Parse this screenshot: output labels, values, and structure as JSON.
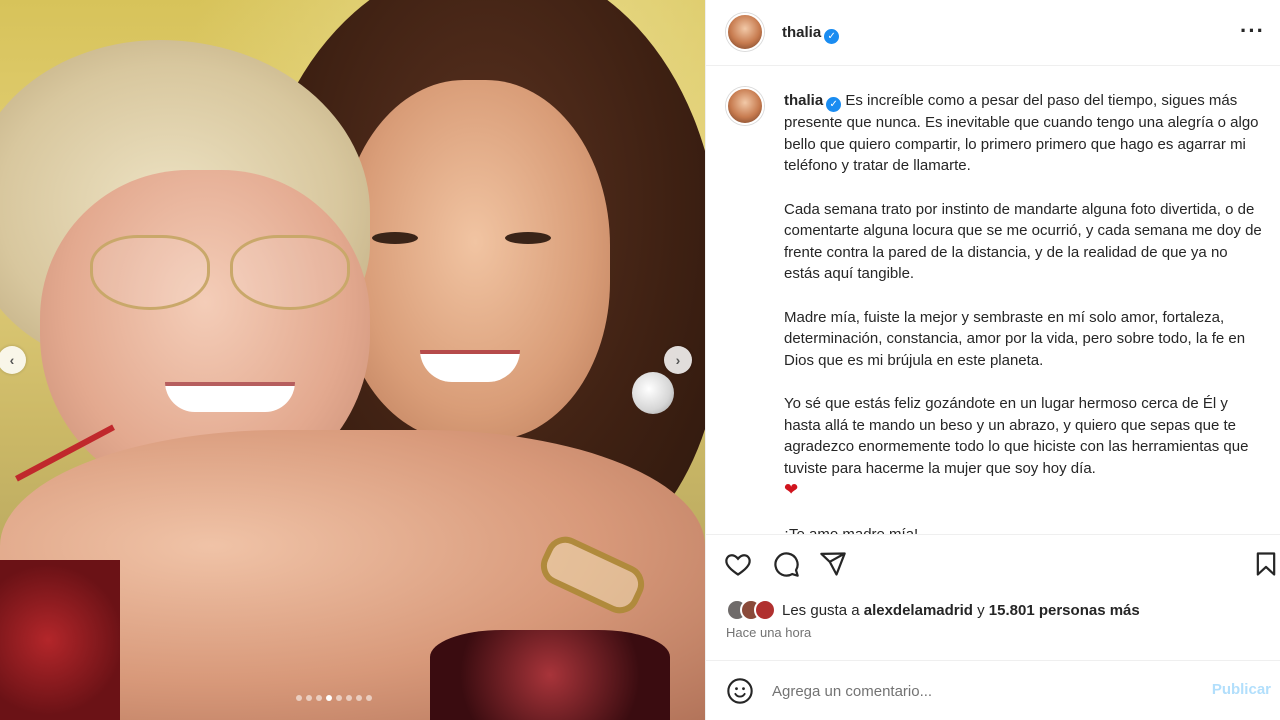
{
  "post": {
    "username": "thalia",
    "verified_icon": "verified-badge-icon",
    "more_icon": "more-options-icon"
  },
  "caption": {
    "username": "thalia",
    "paragraphs": [
      "Es increíble como a pesar del paso del tiempo, sigues más presente que nunca. Es inevitable que cuando tengo una alegría o algo bello que quiero compartir, lo primero primero que hago es agarrar mi teléfono y tratar de llamarte.",
      "Cada semana trato por instinto de mandarte alguna foto divertida, o de comentarte alguna locura que se me ocurrió, y cada semana me doy de frente contra la pared de la distancia, y de la realidad de que ya no estás aquí tangible.",
      "Madre mía, fuiste la mejor y sembraste en mí solo amor, fortaleza, determinación, constancia, amor por la vida, pero sobre todo, la fe en Dios que es mi brújula en este planeta.",
      "Yo sé que estás feliz gozándote en un lugar hermoso cerca de Él y hasta allá te mando un beso y un abrazo, y quiero que sepas que te agradezco enormemente todo lo que hiciste con las herramientas que tuviste para hacerme la mujer que soy hoy día.",
      "¡Te amo madre mía!"
    ],
    "emoji": "❤"
  },
  "carousel": {
    "prev_label": "‹",
    "next_label": "›",
    "total": 8,
    "active_index": 3
  },
  "likes": {
    "prefix": "Les gusta a",
    "user": "alexdelamadrid",
    "middle": "y",
    "count": "15.801 personas más"
  },
  "time": "Hace una hora",
  "comment": {
    "placeholder": "Agrega un comentario...",
    "publish": "Publicar"
  },
  "colors": {
    "verified": "#1a8cf1",
    "publish_disabled": "#b2dffc",
    "heart": "#d0141e"
  }
}
